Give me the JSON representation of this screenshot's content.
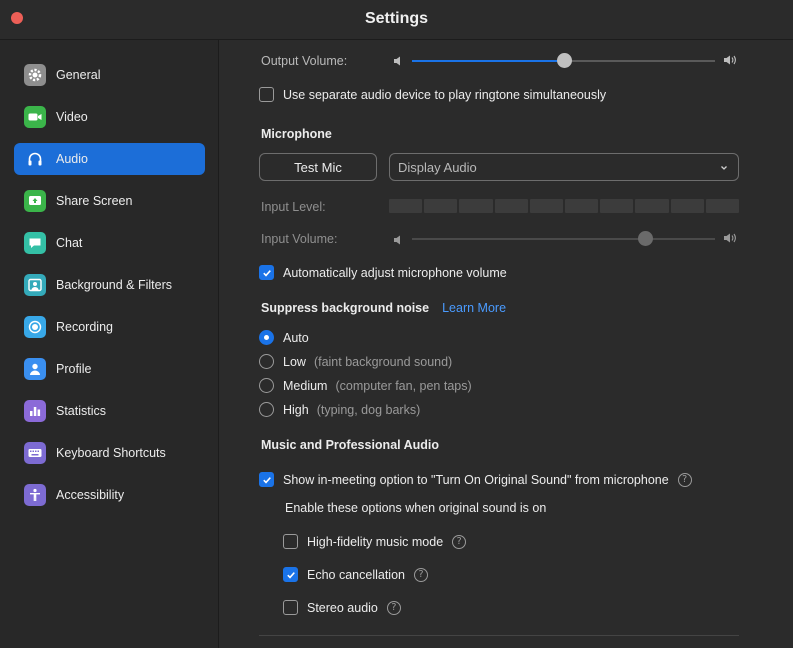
{
  "window": {
    "title": "Settings"
  },
  "sidebar": {
    "items": [
      {
        "label": "General",
        "icon": "gear-icon",
        "color": "#8e8e8e",
        "active": false
      },
      {
        "label": "Video",
        "icon": "video-camera-icon",
        "color": "#3bb54a",
        "active": false
      },
      {
        "label": "Audio",
        "icon": "headphones-icon",
        "color": "#1c6ed8",
        "active": true
      },
      {
        "label": "Share Screen",
        "icon": "share-screen-icon",
        "color": "#3bb54a",
        "active": false
      },
      {
        "label": "Chat",
        "icon": "chat-bubble-icon",
        "color": "#34c0a6",
        "active": false
      },
      {
        "label": "Background & Filters",
        "icon": "background-person-icon",
        "color": "#34aaba",
        "active": false
      },
      {
        "label": "Recording",
        "icon": "record-icon",
        "color": "#38a8e8",
        "active": false
      },
      {
        "label": "Profile",
        "icon": "profile-person-icon",
        "color": "#3a8ff0",
        "active": false
      },
      {
        "label": "Statistics",
        "icon": "bar-chart-icon",
        "color": "#8b6ad8",
        "active": false
      },
      {
        "label": "Keyboard Shortcuts",
        "icon": "keyboard-icon",
        "color": "#7d6bd2",
        "active": false
      },
      {
        "label": "Accessibility",
        "icon": "accessibility-icon",
        "color": "#7d6bd2",
        "active": false
      }
    ]
  },
  "speaker": {
    "output_volume_label": "Output Volume:",
    "output_volume_level": 0.5,
    "separate_ringtone_label": "Use separate audio device to play ringtone simultaneously",
    "separate_ringtone_checked": false
  },
  "microphone": {
    "heading": "Microphone",
    "test_mic_label": "Test Mic",
    "device_selected": "Display Audio",
    "input_level_label": "Input Level:",
    "input_level_segments": 10,
    "input_volume_label": "Input Volume:",
    "input_volume_level": 0.77,
    "auto_adjust_label": "Automatically adjust microphone volume",
    "auto_adjust_checked": true
  },
  "noise": {
    "heading": "Suppress background noise",
    "learn_more": "Learn More",
    "options": [
      {
        "label": "Auto",
        "hint": "",
        "selected": true
      },
      {
        "label": "Low",
        "hint": "(faint background sound)",
        "selected": false
      },
      {
        "label": "Medium",
        "hint": "(computer fan, pen taps)",
        "selected": false
      },
      {
        "label": "High",
        "hint": "(typing, dog barks)",
        "selected": false
      }
    ]
  },
  "music": {
    "heading": "Music and Professional Audio",
    "original_sound_label": "Show in-meeting option to \"Turn On Original Sound\" from microphone",
    "original_sound_checked": true,
    "sub_heading": "Enable these options when original sound is on",
    "options": [
      {
        "label": "High-fidelity music mode",
        "checked": false
      },
      {
        "label": "Echo cancellation",
        "checked": true
      },
      {
        "label": "Stereo audio",
        "checked": false
      }
    ]
  },
  "colors": {
    "accent": "#1a73e8",
    "close": "#ed5f57",
    "link": "#4a9bff"
  }
}
